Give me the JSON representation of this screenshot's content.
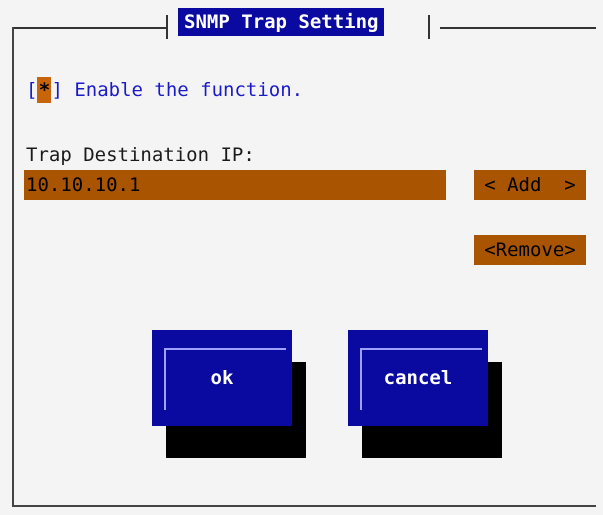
{
  "dialog": {
    "title": "SNMP Trap Setting"
  },
  "enable": {
    "bracket_open": "[",
    "mark": "*",
    "bracket_close": "]",
    "label": " Enable the function.",
    "checked": true
  },
  "trap": {
    "label": "Trap Destination IP:",
    "value": "10.10.10.1"
  },
  "buttons": {
    "add": "< Add  >",
    "remove": "<Remove>",
    "ok": "ok",
    "cancel": "cancel"
  },
  "colors": {
    "title_bg": "#0a0aa0",
    "field_bg": "#a85400",
    "text_blue": "#1a1ac8"
  }
}
